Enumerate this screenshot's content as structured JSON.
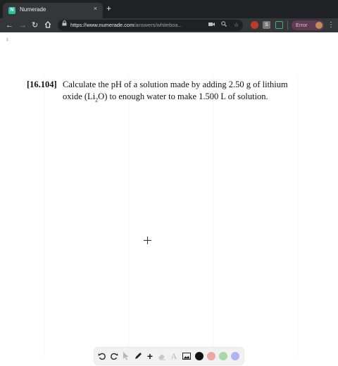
{
  "browser": {
    "tab": {
      "title": "Numerade",
      "favicon_letter": "N",
      "close_glyph": "×"
    },
    "new_tab_glyph": "+",
    "url": {
      "host": "https://www.numerade.com",
      "path": "/answers/whiteboa..."
    },
    "error_label": "Error",
    "extension_letter": "S"
  },
  "page": {
    "page_number": "1",
    "problem": {
      "number": "[16.104]",
      "text_before": "Calculate the pH of a solution made by adding 2.50 g of lithium oxide (Li",
      "subscript": "2",
      "text_after": "O) to enough water to make 1.500 L of solution."
    }
  },
  "palette": {
    "colors": [
      "#111111",
      "#f1a6a6",
      "#a8d8a8",
      "#b0b4ee"
    ]
  },
  "colors": {
    "chrome_dark": "#202124",
    "chrome_toolbar": "#35363a",
    "brand": "#2fbf9f"
  }
}
